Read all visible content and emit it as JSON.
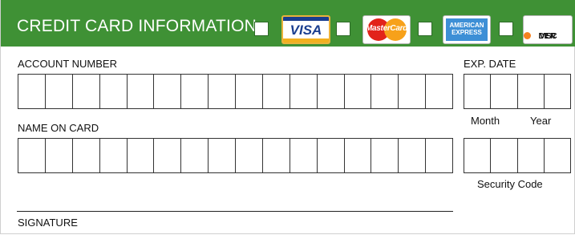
{
  "header": {
    "title": "CREDIT CARD INFORMATION",
    "card_options": [
      {
        "name": "Visa",
        "logo_text": "VISA"
      },
      {
        "name": "MasterCard",
        "logo_text": "MasterCard"
      },
      {
        "name": "American Express",
        "logo_text_line1": "AMERICAN",
        "logo_text_line2": "EXPRESS"
      },
      {
        "name": "Discover",
        "logo_text_pre": "DISC",
        "logo_text_post": "VER"
      }
    ]
  },
  "fields": {
    "account_number_label": "ACCOUNT NUMBER",
    "account_number_boxes": 16,
    "name_on_card_label": "NAME ON CARD",
    "name_on_card_boxes": 16,
    "exp_date_label": "EXP. DATE",
    "exp_date_boxes": 4,
    "month_label": "Month",
    "year_label": "Year",
    "security_code_boxes": 4,
    "security_code_label": "Security Code",
    "signature_label": "SIGNATURE"
  },
  "colors": {
    "header_green": "#3f9135",
    "visa_blue": "#1a3e8f",
    "mastercard_red": "#e2231a",
    "mastercard_orange": "#f7a11a",
    "amex_blue": "#3d8fd6",
    "discover_orange": "#f58220"
  }
}
